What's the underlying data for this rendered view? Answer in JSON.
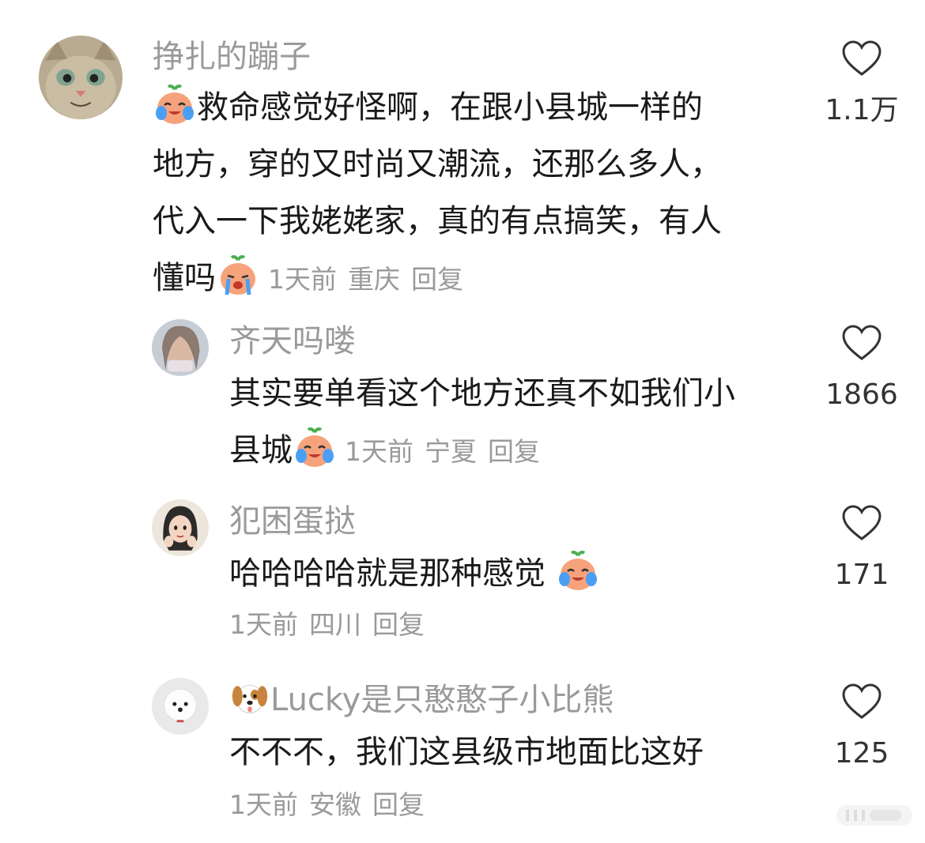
{
  "colors": {
    "text": "#1a1a1a",
    "muted": "#9a9a9a",
    "emoji_face": "#f6a37c",
    "emoji_tear": "#4a9ff5"
  },
  "comments": [
    {
      "username": "挣扎的蹦子",
      "lines": [
        "救命感觉好怪啊，在跟小县城一样的",
        "地方，穿的又时尚又潮流，还那么多人，",
        "代入一下我姥姥家，真的有点搞笑，有人",
        "懂吗"
      ],
      "time": "1天前",
      "location": "重庆",
      "reply": "回复",
      "likes": "1.1万",
      "avatar_icon": "cat-avatar"
    },
    {
      "username": "齐天吗喽",
      "lines": [
        "其实要单看这个地方还真不如我们小",
        "县城"
      ],
      "time": "1天前",
      "location": "宁夏",
      "reply": "回复",
      "likes": "1866",
      "avatar_icon": "girl-avatar"
    },
    {
      "username": "犯困蛋挞",
      "lines": [
        "哈哈哈哈就是那种感觉"
      ],
      "time": "1天前",
      "location": "四川",
      "reply": "回复",
      "likes": "171",
      "avatar_icon": "anime-girl-avatar"
    },
    {
      "username": "Lucky是只憨憨子小比熊",
      "lines": [
        "不不不，我们这县级市地面比这好"
      ],
      "time": "1天前",
      "location": "安徽",
      "reply": "回复",
      "likes": "125",
      "avatar_icon": "dog-avatar"
    }
  ]
}
